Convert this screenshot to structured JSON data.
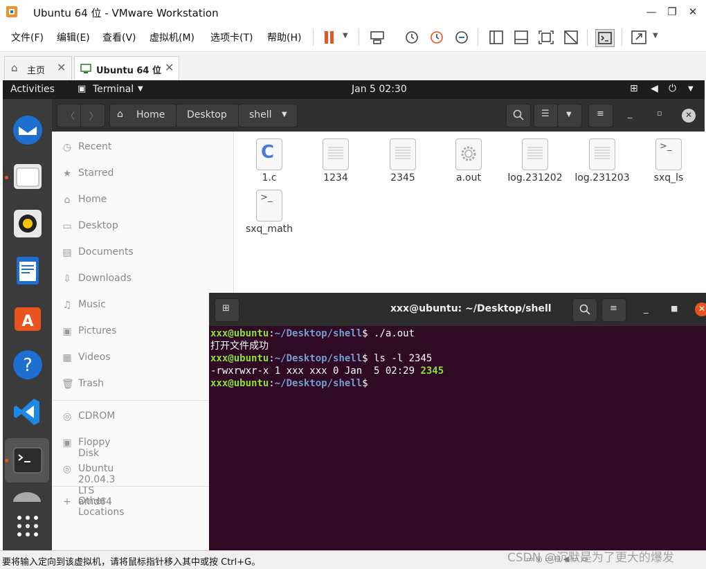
{
  "window": {
    "title": "Ubuntu 64 位 - VMware Workstation",
    "min": "—",
    "max": "❐",
    "close": "✕"
  },
  "menu": [
    "文件(F)",
    "编辑(E)",
    "查看(V)",
    "虚拟机(M)",
    "选项卡(T)",
    "帮助(H)"
  ],
  "tabs": [
    {
      "label": "主页"
    },
    {
      "label": "Ubuntu 64 位"
    }
  ],
  "topbar": {
    "activities": "Activities",
    "app": "Terminal",
    "clock": "Jan 5  02:30"
  },
  "nautilus": {
    "path": [
      "Home",
      "Desktop",
      "shell"
    ],
    "sidebar": [
      "Recent",
      "Starred",
      "Home",
      "Desktop",
      "Documents",
      "Downloads",
      "Music",
      "Pictures",
      "Videos",
      "Trash"
    ],
    "devices": [
      "CDROM",
      "Floppy Disk",
      "Ubuntu 20.04.3 LTS amd64"
    ],
    "other": "Other Locations",
    "files": [
      "1.c",
      "1234",
      "2345",
      "a.out",
      "log.231202",
      "log.231203",
      "sxq_ls",
      "sxq_math"
    ]
  },
  "terminal": {
    "title": "xxx@ubuntu: ~/Desktop/shell",
    "user": "xxx@ubuntu",
    "path": "~/Desktop/shell",
    "cmd1": " ./a.out",
    "out1": "打开文件成功",
    "cmd2": " ls -l 2345",
    "out2_prefix": "-rwxrwxr-x 1 xxx xxx 0 Jan  5 02:29 ",
    "out2_file": "2345"
  },
  "status": {
    "text": "要将输入定向到该虚拟机，请将鼠标指针移入其中或按 Ctrl+G。",
    "watermark": "CSDN @沉默是为了更大的爆发"
  },
  "colors": {
    "accent": "#e95420",
    "term_bg": "#300a24",
    "prompt_user": "#8ae234",
    "prompt_path": "#729fcf"
  }
}
